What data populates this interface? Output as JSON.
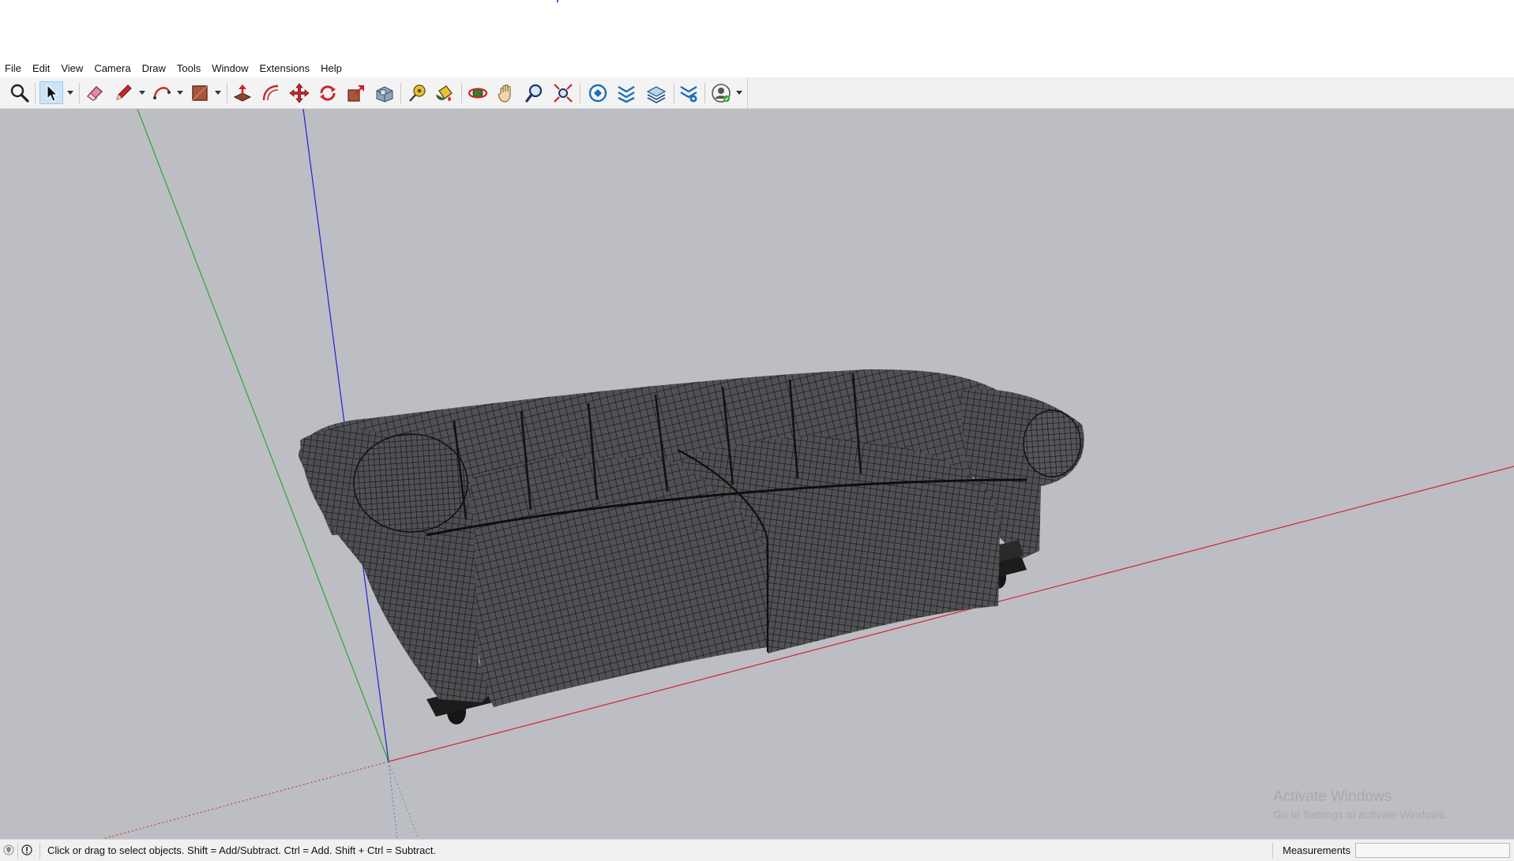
{
  "menu": [
    "File",
    "Edit",
    "View",
    "Camera",
    "Draw",
    "Tools",
    "Window",
    "Extensions",
    "Help"
  ],
  "toolbar": {
    "tools": [
      {
        "name": "zoom-extents",
        "icon": "magnifier-icon"
      },
      {
        "name": "select",
        "icon": "arrow-cursor-icon",
        "active": true
      },
      {
        "name": "eraser",
        "icon": "eraser-icon"
      },
      {
        "name": "line",
        "icon": "pencil-icon"
      },
      {
        "name": "arc",
        "icon": "arc-icon"
      },
      {
        "name": "shapes",
        "icon": "rectangle-icon"
      },
      {
        "name": "push-pull",
        "icon": "push-pull-icon"
      },
      {
        "name": "offset",
        "icon": "offset-icon"
      },
      {
        "name": "move",
        "icon": "move-icon"
      },
      {
        "name": "rotate",
        "icon": "rotate-icon"
      },
      {
        "name": "scale",
        "icon": "scale-icon"
      },
      {
        "name": "follow-me",
        "icon": "follow-me-icon"
      },
      {
        "name": "tape-measure",
        "icon": "tape-measure-icon"
      },
      {
        "name": "paint-bucket",
        "icon": "paint-bucket-icon"
      },
      {
        "name": "orbit",
        "icon": "orbit-icon"
      },
      {
        "name": "pan",
        "icon": "pan-hand-icon"
      },
      {
        "name": "zoom",
        "icon": "zoom-icon"
      },
      {
        "name": "zoom-extents-2",
        "icon": "zoom-extents-icon"
      },
      {
        "name": "3d-warehouse",
        "icon": "warehouse-icon"
      },
      {
        "name": "extension-warehouse",
        "icon": "extension-warehouse-icon"
      },
      {
        "name": "layout",
        "icon": "layout-icon"
      },
      {
        "name": "extension-manager",
        "icon": "extension-manager-icon"
      },
      {
        "name": "account",
        "icon": "account-icon"
      }
    ]
  },
  "colors": {
    "viewport_bg": "#bcbec4",
    "axis_red": "#d4242a",
    "axis_green": "#2ea52e",
    "axis_blue": "#2222cc",
    "mesh_line": "#1a1a1a",
    "sofa_fill": "#4a4b4e"
  },
  "watermark": {
    "title": "Activate Windows",
    "subtitle": "Go to Settings to activate Windows."
  },
  "status": {
    "hint": "Click or drag to select objects. Shift = Add/Subtract. Ctrl = Add. Shift + Ctrl = Subtract.",
    "measurements_label": "Measurements",
    "measurements_value": ""
  }
}
